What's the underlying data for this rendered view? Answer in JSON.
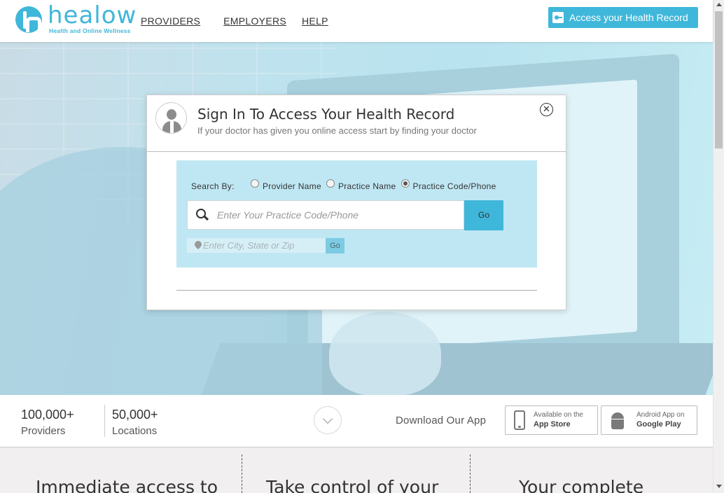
{
  "header": {
    "logo_word": "healow",
    "logo_tagline": "Health and Online Wellness",
    "nav": [
      "PROVIDERS",
      "EMPLOYERS",
      "HELP"
    ],
    "access_button": "Access your Health Record"
  },
  "modal": {
    "title": "Sign In To Access Your Health Record",
    "subtitle": "If your doctor has given you online access start by finding your doctor",
    "close_symbol": "✕",
    "search_by_label": "Search By:",
    "radio_options": [
      {
        "label": "Provider Name",
        "selected": false
      },
      {
        "label": "Practice Name",
        "selected": false
      },
      {
        "label": "Practice Code/Phone",
        "selected": true
      }
    ],
    "code_input": {
      "placeholder": "Enter Your Practice Code/Phone",
      "value": ""
    },
    "go_label": "Go",
    "location_input": {
      "placeholder": "Enter City, State or Zip",
      "value": ""
    },
    "location_go_label": "Go"
  },
  "stats": [
    {
      "number": "100,000+",
      "label": "Providers"
    },
    {
      "number": "50,000+",
      "label": "Locations"
    }
  ],
  "download": {
    "label": "Download Our App",
    "app_store": {
      "line1": "Available on the",
      "line2": "App Store"
    },
    "google_play": {
      "line1": "Android App on",
      "line2": "Google Play"
    }
  },
  "features": [
    "Immediate access to",
    "Take control of your",
    "Your complete"
  ],
  "colors": {
    "brand": "#3fb7da",
    "panel": "#bfe7f3"
  },
  "icons": [
    "key-icon",
    "search-icon",
    "location-pin-icon",
    "close-icon",
    "chevron-down-icon",
    "phone-icon",
    "android-icon",
    "doctor-avatar-icon"
  ]
}
